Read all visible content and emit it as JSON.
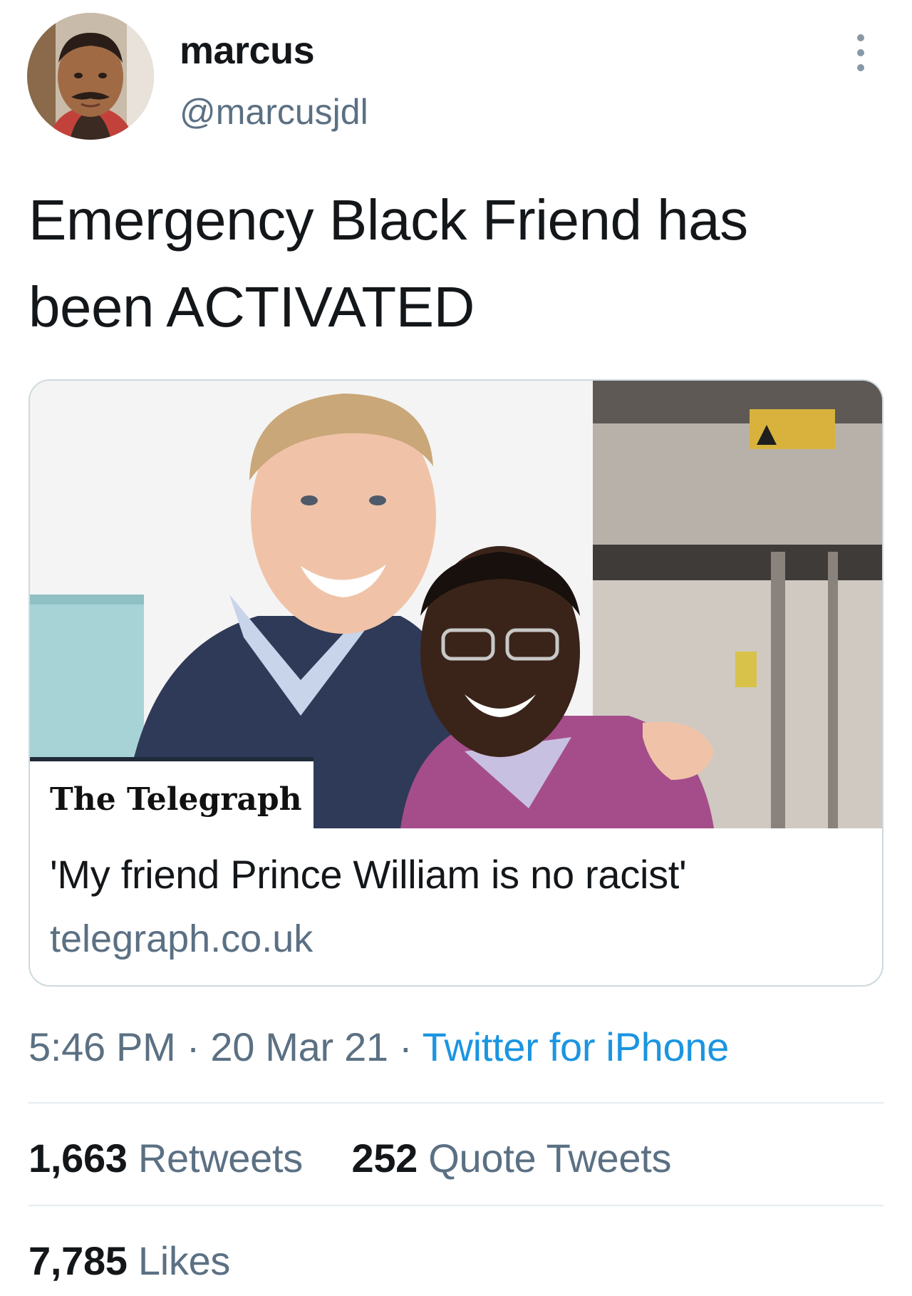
{
  "tweet": {
    "display_name": "marcus",
    "handle": "@marcusjdl",
    "text_line1": "Emergency Black Friend has",
    "text_line2": "been ACTIVATED",
    "more_icon": "more-vertical-icon"
  },
  "card": {
    "publisher_logo": "The Telegraph",
    "title": "'My friend Prince William is no racist'",
    "domain": "telegraph.co.uk"
  },
  "meta": {
    "time": "5:46 PM",
    "separator": "·",
    "date": "20 Mar 21",
    "source": "Twitter for iPhone"
  },
  "stats": {
    "retweets_count": "1,663",
    "retweets_label": "Retweets",
    "quotes_count": "252",
    "quotes_label": "Quote Tweets",
    "likes_count": "7,785",
    "likes_label": "Likes"
  },
  "colors": {
    "secondary_text": "#5b7083",
    "link_blue": "#1b95e0",
    "border": "#cfd9de"
  }
}
